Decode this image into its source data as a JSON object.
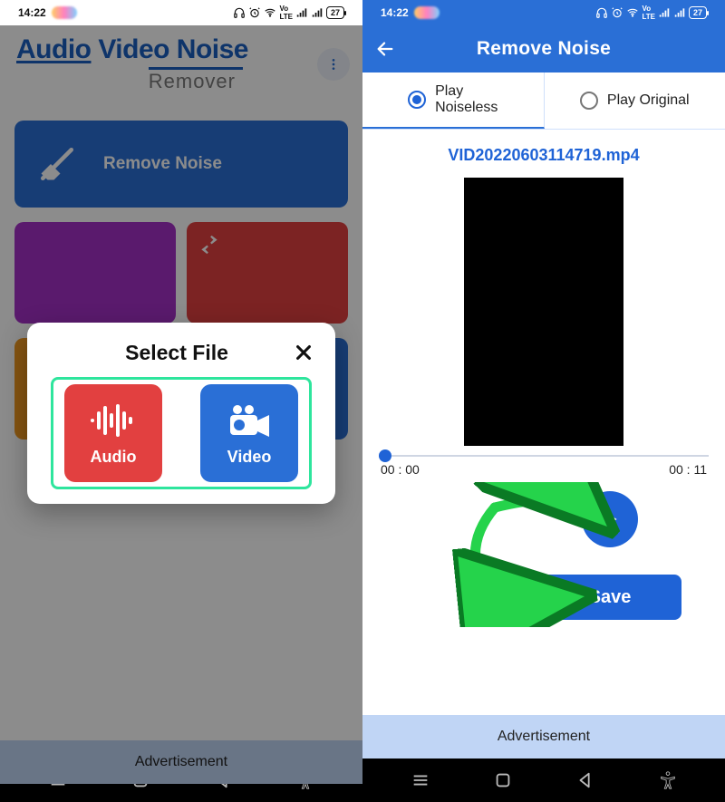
{
  "status": {
    "time": "14:22",
    "battery": "27"
  },
  "phone1": {
    "app": {
      "title_audio": "Audio",
      "title_rest": " Video Noise",
      "subtitle": "Remover"
    },
    "remove_noise_label": "Remove Noise",
    "modal": {
      "title": "Select File",
      "audio_label": "Audio",
      "video_label": "Video"
    },
    "ad_label": "Advertisement"
  },
  "phone2": {
    "appbar_title": "Remove Noise",
    "tabs": {
      "noiseless": "Play\nNoiseless",
      "original": "Play Original"
    },
    "filename": "VID20220603114719.mp4",
    "time_start": "00 : 00",
    "time_end": "00 : 11",
    "save_label": "Save",
    "ad_label": "Advertisement"
  }
}
